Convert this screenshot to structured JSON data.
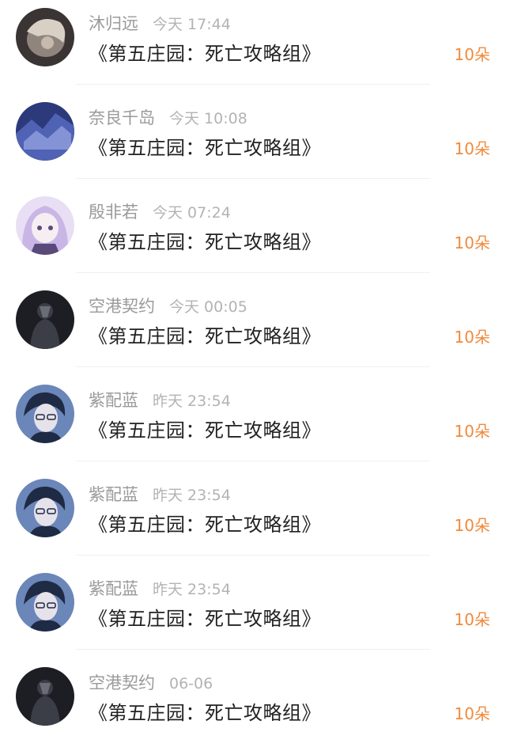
{
  "gifts": [
    {
      "user": "沐归远",
      "time": "今天 17:44",
      "book": "《第五庄园：死亡攻略组》",
      "amount": "10朵",
      "avatar_icon": "avatar-white-haired-figure",
      "avatar_palette": [
        "#3a3434",
        "#8f857c",
        "#d8d0c4"
      ]
    },
    {
      "user": "奈良千岛",
      "time": "今天 10:08",
      "book": "《第五庄园：死亡攻略组》",
      "amount": "10朵",
      "avatar_icon": "avatar-blue-illustration",
      "avatar_palette": [
        "#2c3a7c",
        "#4f62b4",
        "#9aa8e4"
      ]
    },
    {
      "user": "殷非若",
      "time": "今天 07:24",
      "book": "《第五庄园：死亡攻略组》",
      "amount": "10朵",
      "avatar_icon": "avatar-anime-girl-lavender",
      "avatar_palette": [
        "#c9b6e6",
        "#e9dff4",
        "#5a4a7a"
      ]
    },
    {
      "user": "空港契约",
      "time": "今天 00:05",
      "book": "《第五庄园：死亡攻略组》",
      "amount": "10朵",
      "avatar_icon": "avatar-dark-figure",
      "avatar_palette": [
        "#1c1e24",
        "#3b3e46",
        "#8a8e96"
      ]
    },
    {
      "user": "紫配蓝",
      "time": "昨天 23:54",
      "book": "《第五庄园：死亡攻略组》",
      "amount": "10朵",
      "avatar_icon": "avatar-anime-boy-glasses",
      "avatar_palette": [
        "#1f2a44",
        "#6b86b8",
        "#e6e2ea"
      ]
    },
    {
      "user": "紫配蓝",
      "time": "昨天 23:54",
      "book": "《第五庄园：死亡攻略组》",
      "amount": "10朵",
      "avatar_icon": "avatar-anime-boy-glasses",
      "avatar_palette": [
        "#1f2a44",
        "#6b86b8",
        "#e6e2ea"
      ]
    },
    {
      "user": "紫配蓝",
      "time": "昨天 23:54",
      "book": "《第五庄园：死亡攻略组》",
      "amount": "10朵",
      "avatar_icon": "avatar-anime-boy-glasses",
      "avatar_palette": [
        "#1f2a44",
        "#6b86b8",
        "#e6e2ea"
      ]
    },
    {
      "user": "空港契约",
      "time": "06-06",
      "book": "《第五庄园：死亡攻略组》",
      "amount": "10朵",
      "avatar_icon": "avatar-dark-figure",
      "avatar_palette": [
        "#1c1e24",
        "#3b3e46",
        "#8a8e96"
      ]
    }
  ],
  "colors": {
    "accent": "#f08a3c",
    "name_text": "#9a9a9a",
    "time_text": "#b3b3b3",
    "title_text": "#222222"
  }
}
